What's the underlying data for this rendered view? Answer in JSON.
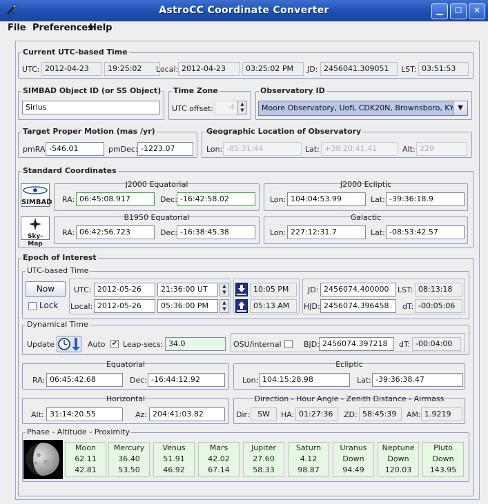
{
  "window": {
    "title": "AstroCC Coordinate Converter"
  },
  "menu": {
    "items": [
      "File",
      "Preferences",
      "Help"
    ]
  },
  "utc": {
    "legend": "Current UTC-based Time",
    "utc_label": "UTC:",
    "date": "2012-04-23",
    "time": "19:25:02",
    "local_label": "Local:",
    "local_date": "2012-04-23",
    "local_time": "03:25:02 PM",
    "jd_label": "JD:",
    "jd": "2456041.309051",
    "lst_label": "LST:",
    "lst": "03:51:53"
  },
  "simbad": {
    "legend": "SIMBAD Object ID (or SS Object)",
    "value": "Sirius"
  },
  "timezone": {
    "legend": "Time Zone",
    "label": "UTC offset:",
    "value": "-4"
  },
  "observatory": {
    "legend": "Observatory ID",
    "value": "Moore Observatory, UofL CDK20N, Brownsboro, KY"
  },
  "proper_motion": {
    "legend": "Target Proper Motion (mas /yr)",
    "pmra_label": "pmRA:",
    "pmra": "-546.01",
    "pmdec_label": "pmDec:",
    "pmdec": "-1223.07"
  },
  "geo": {
    "legend": "Geographic Location of Observatory",
    "lon_label": "Lon:",
    "lon": "-85:31:44",
    "lat_label": "Lat:",
    "lat": "+38:20:41.41",
    "alt_label": "Alt:",
    "alt": "229"
  },
  "standard": {
    "legend": "Standard Coordinates",
    "simbad_logo": "SIMBAD",
    "skymap_logo": "Sky-Map",
    "j2000_eq": {
      "title": "J2000 Equatorial",
      "ra_label": "RA:",
      "ra": "06:45:08.917",
      "dec_label": "Dec:",
      "dec": "-16:42:58.02"
    },
    "j2000_ecl": {
      "title": "J2000 Ecliptic",
      "lon_label": "Lon:",
      "lon": "104:04:53.99",
      "lat_label": "Lat:",
      "lat": "-39:36:18.9"
    },
    "b1950_eq": {
      "title": "B1950 Equatorial",
      "ra_label": "RA:",
      "ra": "06:42:56.723",
      "dec_label": "Dec:",
      "dec": "-16:38:45.38"
    },
    "galactic": {
      "title": "Galactic",
      "lon_label": "Lon:",
      "lon": "227:12:31.7",
      "lat_label": "Lat:",
      "lat": "-08:53:42.57"
    }
  },
  "epoch": {
    "legend": "Epoch of Interest",
    "utc_time": {
      "legend": "UTC-based Time",
      "now_button": "Now",
      "lock_label": "Lock",
      "utc_label": "UTC:",
      "utc_date": "2012-05-26",
      "utc_time": "21:36:00 UT",
      "local_label": "Local:",
      "local_date": "2012-05-26",
      "local_time": "05:36:00 PM",
      "set_time": "10:05 PM",
      "rise_time": "05:13 AM",
      "jd_label": "JD:",
      "jd": "2456074.400000",
      "lst_label": "LST:",
      "lst": "08:13:18",
      "hjd_label": "HJD:",
      "hjd": "2456074.396458",
      "dt_label": "dT:",
      "dt": "-00:05:06"
    },
    "dynamical": {
      "legend": "Dynamical Time",
      "update_label": "Update",
      "auto_label": "Auto",
      "auto_checked": "✔",
      "leap_label": "Leap-secs:",
      "leap": "34.0",
      "osu_label": "OSU/internal",
      "bjd_label": "BJD:",
      "bjd": "2456074.397218",
      "dt_label": "dT:",
      "dt": "-00:04:00"
    },
    "equatorial": {
      "title": "Equatorial",
      "ra_label": "RA:",
      "ra": "06:45:42.68",
      "dec_label": "Dec:",
      "dec": "-16:44:12.92"
    },
    "ecliptic": {
      "title": "Ecliptic",
      "lon_label": "Lon:",
      "lon": "104:15:28.98",
      "lat_label": "Lat:",
      "lat": "-39:36:38.47"
    },
    "horizontal": {
      "title": "Horizontal",
      "alt_label": "Alt:",
      "alt": "31:14:20.55",
      "az_label": "Az:",
      "az": "204:41:03.82"
    },
    "direction": {
      "title": "Direction - Hour Angle - Zenith Distance - Airmass",
      "dir_label": "Dir:",
      "dir": "SW",
      "ha_label": "HA:",
      "ha": "01:27:36",
      "zd_label": "ZD:",
      "zd": "58:45:39",
      "am_label": "AM:",
      "am": "1.9219"
    },
    "phase": {
      "legend": "Phase - Altitude - Proximity",
      "planets": [
        {
          "name": "Moon",
          "altitude": "62.11",
          "proximity": "42.81"
        },
        {
          "name": "Mercury",
          "altitude": "36.40",
          "proximity": "53.50"
        },
        {
          "name": "Venus",
          "altitude": "51.91",
          "proximity": "46.92"
        },
        {
          "name": "Mars",
          "altitude": "42.02",
          "proximity": "67.14"
        },
        {
          "name": "Jupiter",
          "altitude": "27.60",
          "proximity": "58.33"
        },
        {
          "name": "Saturn",
          "altitude": "4.12",
          "proximity": "98.87"
        },
        {
          "name": "Uranus",
          "altitude": "Down",
          "proximity": "94.49"
        },
        {
          "name": "Neptune",
          "altitude": "Down",
          "proximity": "120.03"
        },
        {
          "name": "Pluto",
          "altitude": "Down",
          "proximity": "143.95"
        }
      ]
    }
  }
}
